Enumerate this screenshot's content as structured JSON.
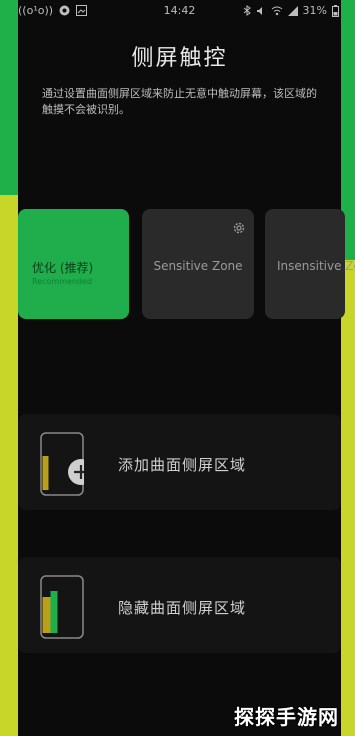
{
  "status_bar": {
    "left_text": "((o¹o))",
    "time": "14:42",
    "battery": "31%"
  },
  "page": {
    "title": "侧屏触控",
    "description": "通过设置曲面侧屏区域来防止无意中触动屏幕，该区域的触摸不会被识别。"
  },
  "zones": [
    {
      "label": "优化 (推荐)",
      "sublabel": "Recommended",
      "selected": true
    },
    {
      "label": "Sensitive Zone",
      "selected": false
    },
    {
      "label": "Insensitive Zo",
      "selected": false
    }
  ],
  "actions": {
    "add_label": "添加曲面侧屏区域",
    "hide_label": "隐藏曲面侧屏区域"
  },
  "watermark": "探探手游网",
  "colors": {
    "accent_green": "#1fae4b",
    "edge_yellow": "#c8d62a",
    "background": "#0b0b0b"
  },
  "icons": [
    "wifi-icon",
    "bluetooth-icon",
    "battery-icon",
    "settings-icon",
    "add-circle-icon",
    "phone-edge-icon"
  ]
}
